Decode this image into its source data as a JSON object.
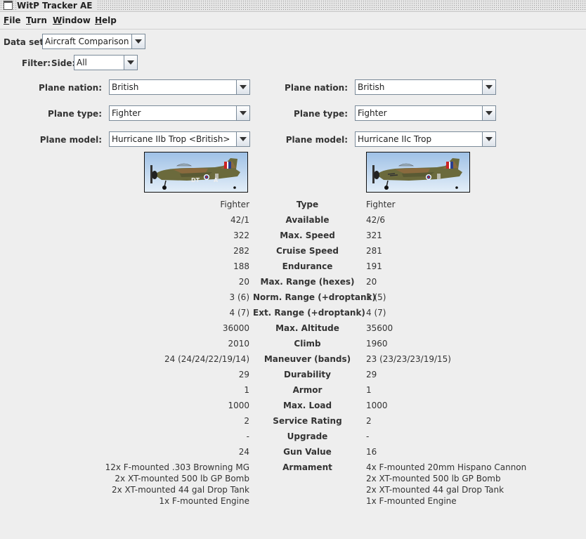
{
  "window": {
    "title": "WitP Tracker AE"
  },
  "menu": [
    {
      "u": "F",
      "rest": "ile"
    },
    {
      "u": "T",
      "rest": "urn"
    },
    {
      "u": "W",
      "rest": "indow"
    },
    {
      "u": "H",
      "rest": "elp"
    }
  ],
  "dataset": {
    "label": "Data set:",
    "value": "Aircraft Comparison"
  },
  "filter": {
    "label": "Filter:",
    "side_label": "Side:",
    "side_value": "All"
  },
  "left": {
    "nation_label": "Plane nation:",
    "nation": "British",
    "type_label": "Plane type:",
    "type": "Fighter",
    "model_label": "Plane model:",
    "model": "Hurricane IIb Trop <British>",
    "image_icon": "hurricane-plane-image"
  },
  "right": {
    "nation_label": "Plane nation:",
    "nation": "British",
    "type_label": "Plane type:",
    "type": "Fighter",
    "model_label": "Plane model:",
    "model": "Hurricane IIc Trop",
    "image_icon": "hurricane-plane-image"
  },
  "stats": [
    {
      "label": "Type",
      "left": "Fighter",
      "right": "Fighter"
    },
    {
      "label": "Available",
      "left": "42/1",
      "right": "42/6"
    },
    {
      "label": "Max. Speed",
      "left": "322",
      "right": "321"
    },
    {
      "label": "Cruise Speed",
      "left": "282",
      "right": "281"
    },
    {
      "label": "Endurance",
      "left": "188",
      "right": "191"
    },
    {
      "label": "Max. Range (hexes)",
      "left": "20",
      "right": "20"
    },
    {
      "label": "Norm. Range (+droptank)",
      "left": "3 (6)",
      "right": "3 (5)"
    },
    {
      "label": "Ext. Range (+droptank)",
      "left": "4 (7)",
      "right": "4 (7)"
    },
    {
      "label": "Max. Altitude",
      "left": "36000",
      "right": "35600"
    },
    {
      "label": "Climb",
      "left": "2010",
      "right": "1960"
    },
    {
      "label": "Maneuver (bands)",
      "left": "24 (24/24/22/19/14)",
      "right": "23 (23/23/23/19/15)"
    },
    {
      "label": "Durability",
      "left": "29",
      "right": "29"
    },
    {
      "label": "Armor",
      "left": "1",
      "right": "1"
    },
    {
      "label": "Max. Load",
      "left": "1000",
      "right": "1000"
    },
    {
      "label": "Service Rating",
      "left": "2",
      "right": "2"
    },
    {
      "label": "Upgrade",
      "left": "-",
      "right": "-"
    },
    {
      "label": "Gun Value",
      "left": "24",
      "right": "16"
    }
  ],
  "armament": {
    "label": "Armament",
    "left": [
      "12x F-mounted .303 Browning MG",
      "2x XT-mounted 500 lb GP Bomb",
      "2x XT-mounted 44 gal Drop Tank",
      "1x F-mounted Engine"
    ],
    "right": [
      "4x F-mounted 20mm Hispano Cannon",
      "2x XT-mounted 500 lb GP Bomb",
      "2x XT-mounted 44 gal Drop Tank",
      "1x F-mounted Engine"
    ]
  },
  "colors": {
    "background": "#eeeeee",
    "sky": "#b9d3ee",
    "camo_green": "#6b6a3c",
    "camo_brown": "#8a6a3e"
  }
}
